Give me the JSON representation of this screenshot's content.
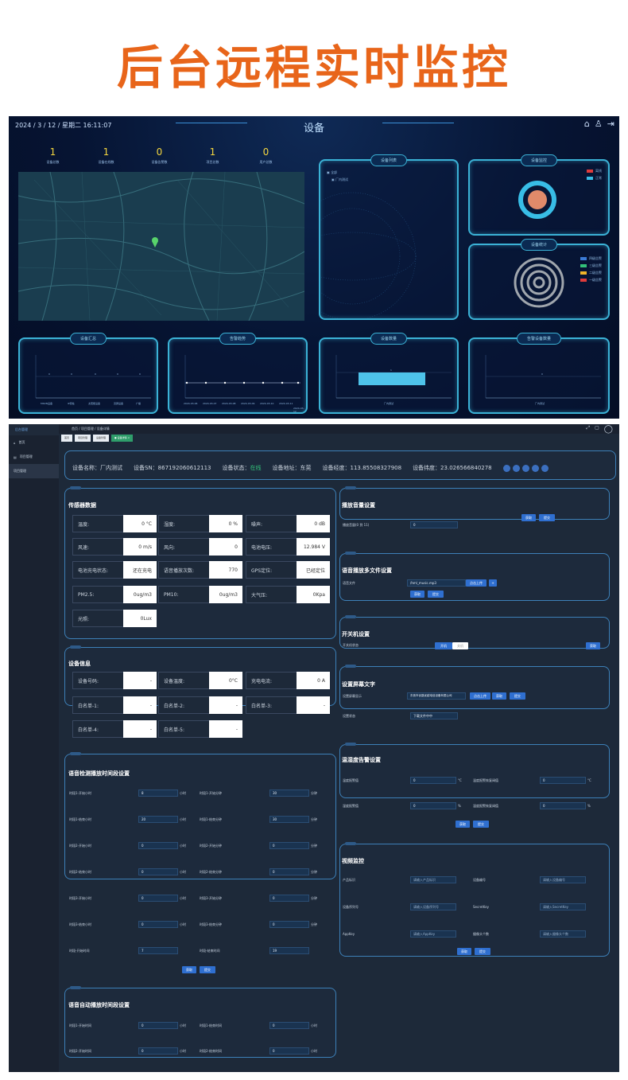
{
  "banner": {
    "title": "后台远程实时监控"
  },
  "dashboard": {
    "datetime": "2024 / 3 / 12 / 星期二 16:11:07",
    "title": "设备",
    "title_sub": "~~",
    "icons": [
      "home-icon",
      "user-icon",
      "logout-icon"
    ],
    "stats": [
      {
        "value": "1",
        "label": "设备总数"
      },
      {
        "value": "1",
        "label": "设备在线数"
      },
      {
        "value": "0",
        "label": "设备告警数"
      },
      {
        "value": "1",
        "label": "项目总数"
      },
      {
        "value": "0",
        "label": "用户总数"
      }
    ],
    "device_list": {
      "title": "设备列表",
      "items": [
        "全部",
        "厂内测试"
      ]
    },
    "device_monitor": {
      "title": "设备监控",
      "legend": [
        "离线",
        "正常"
      ],
      "colors": {
        "ring": "#38bde6",
        "core": "#e08a6a"
      }
    },
    "device_stats": {
      "title": "设备统计",
      "legend": [
        "四级告警",
        "三级告警",
        "二级告警",
        "一级告警"
      ],
      "legend_colors": [
        "#3b7bd6",
        "#33c27a",
        "#f0b429",
        "#e03b3b"
      ]
    },
    "bottom_panels": [
      {
        "title": "设备汇总",
        "labels": [
          "MSDN设备",
          "IP音柱",
          "太阳能设备",
          "双屏设备",
          "广播"
        ],
        "values": [
          0,
          0,
          0,
          0,
          0
        ]
      },
      {
        "title": "告警趋势",
        "labels": [
          "2024-03-06",
          "2024-03-07",
          "2024-03-08",
          "2024-03-09",
          "2024-03-10",
          "2024-03-11",
          "2024-03-12"
        ],
        "values": [
          0,
          0,
          0,
          0,
          0,
          0,
          0
        ]
      },
      {
        "title": "设备数量",
        "labels": [
          "厂内测试"
        ],
        "values": [
          1
        ]
      },
      {
        "title": "告警设备数量",
        "labels": [
          "厂内测试"
        ],
        "values": [
          0
        ]
      }
    ]
  },
  "admin": {
    "side_logo": "后台管理",
    "side_items": [
      "首页",
      "项目管理",
      "项目管理"
    ],
    "breadcrumb": "首页  /  项目管理  /  设备详情",
    "tabs": [
      "首页",
      "项目管理",
      "设备管理",
      "● 设备详情 ×"
    ],
    "info": {
      "name": "设备名称：厂内测试",
      "sn": "设备SN：867192060612113",
      "status_label": "设备状态：",
      "status_value": "在线",
      "address": "设备地址：东莞",
      "lng": "设备经度：113.85508327908",
      "lat": "设备纬度：23.026566840278"
    },
    "sensor": {
      "title": "传感器数据",
      "cells": [
        {
          "label": "温度:",
          "value": "0 °C"
        },
        {
          "label": "湿度:",
          "value": "0 %"
        },
        {
          "label": "噪声:",
          "value": "0 dB"
        },
        {
          "label": "风速:",
          "value": "0 m/s"
        },
        {
          "label": "风向:",
          "value": "0"
        },
        {
          "label": "电池电压:",
          "value": "12.984 V"
        },
        {
          "label": "电池充电状态:",
          "value": "还在充电"
        },
        {
          "label": "语音播放次数:",
          "value": "770"
        },
        {
          "label": "GPS定位:",
          "value": "已经定位"
        },
        {
          "label": "PM2.5:",
          "value": "0ug/m3"
        },
        {
          "label": "PM10:",
          "value": "0ug/m3"
        },
        {
          "label": "大气压:",
          "value": "0Kpa"
        },
        {
          "label": "光照:",
          "value": "0Lux"
        }
      ]
    },
    "device_info": {
      "title": "设备信息",
      "cells": [
        {
          "label": "设备号码:",
          "value": "-"
        },
        {
          "label": "设备温度:",
          "value": "0°C"
        },
        {
          "label": "充电电流:",
          "value": "0 A"
        },
        {
          "label": "白名单-1:",
          "value": "-"
        },
        {
          "label": "白名单-2:",
          "value": "-"
        },
        {
          "label": "白名单-3:",
          "value": "-"
        },
        {
          "label": "白名单-4:",
          "value": "-"
        },
        {
          "label": "白名单-5:",
          "value": "-"
        }
      ]
    },
    "voice_detect": {
      "title": "语音检测播放时间段设置",
      "rows": [
        [
          {
            "label": "时段1-开始小时",
            "value": "8",
            "unit": "小时"
          },
          {
            "label": "时段1-开始分钟",
            "value": "30",
            "unit": "分钟"
          }
        ],
        [
          {
            "label": "时段1-结束小时",
            "value": "20",
            "unit": "小时"
          },
          {
            "label": "时段1-结束分钟",
            "value": "30",
            "unit": "分钟"
          }
        ],
        [
          {
            "label": "时段2-开始小时",
            "value": "0",
            "unit": "小时"
          },
          {
            "label": "时段2-开始分钟",
            "value": "0",
            "unit": "分钟"
          }
        ],
        [
          {
            "label": "时段2-结束小时",
            "value": "0",
            "unit": "小时"
          },
          {
            "label": "时段2-结束分钟",
            "value": "0",
            "unit": "分钟"
          }
        ],
        [
          {
            "label": "时段3-开始小时",
            "value": "0",
            "unit": "小时"
          },
          {
            "label": "时段3-开始分钟",
            "value": "0",
            "unit": "分钟"
          }
        ],
        [
          {
            "label": "时段3-结束小时",
            "value": "0",
            "unit": "小时"
          },
          {
            "label": "时段3-结束分钟",
            "value": "0",
            "unit": "分钟"
          }
        ],
        [
          {
            "label": "时段-开始时间",
            "value": "7",
            "unit": ""
          },
          {
            "label": "时段-结束时间",
            "value": "19",
            "unit": ""
          }
        ]
      ],
      "btn_get": "获取",
      "btn_submit": "提交"
    },
    "voice_auto": {
      "title": "语音自动播放时间段设置",
      "rows": [
        [
          {
            "label": "时段1-开始时间",
            "value": "0",
            "unit": "小时"
          },
          {
            "label": "时段1-结束时间",
            "value": "0",
            "unit": "小时"
          }
        ],
        [
          {
            "label": "时段2-开始时间",
            "value": "0",
            "unit": "小时"
          },
          {
            "label": "时段2-结束时间",
            "value": "0",
            "unit": "小时"
          }
        ]
      ]
    },
    "volume": {
      "title": "播放音量设置",
      "label": "播放音量(0 到 11)",
      "value": "0",
      "btn_get": "获取",
      "btn_submit": "提交"
    },
    "voice_file": {
      "title": "语音播放多文件设置",
      "label": "语音文件",
      "value": "/hml_music.mp3",
      "btn_upload": "点击上传",
      "btn_plus": "+",
      "btn_get": "获取",
      "btn_submit": "提交"
    },
    "power": {
      "title": "开关机设置",
      "label": "开关机状态",
      "on": "开机",
      "off": "关机",
      "btn": "获取"
    },
    "screen_text": {
      "title": "设置屏幕文字",
      "label1": "设置屏幕显示",
      "value1": "东莞市优路优越电信设备有限公司",
      "btn_upload": "点击上传",
      "btn_get": "获取",
      "btn_submit": "提交",
      "label2": "设置状态",
      "value2": "下载文件中中"
    },
    "temp_alarm": {
      "title": "温湿度告警设置",
      "rows": [
        [
          {
            "label": "温度报警值",
            "value": "0",
            "unit": "°C"
          },
          {
            "label": "温度报警恢复阀值",
            "value": "0",
            "unit": "°C"
          }
        ],
        [
          {
            "label": "湿度报警值",
            "value": "0",
            "unit": "%"
          },
          {
            "label": "湿度报警恢复阀值",
            "value": "0",
            "unit": "%"
          }
        ]
      ],
      "btn_get": "获取",
      "btn_submit": "提交"
    },
    "video": {
      "title": "视频监控",
      "rows": [
        [
          {
            "label": "产品标识",
            "placeholder": "请输入产品标识"
          },
          {
            "label": "设备编号",
            "placeholder": "请输入设备编号"
          }
        ],
        [
          {
            "label": "设备序列号",
            "placeholder": "请输入设备序列号"
          },
          {
            "label": "SecretKey",
            "placeholder": "请输入SecretKey"
          }
        ],
        [
          {
            "label": "AppKey",
            "placeholder": "请输入AppKey"
          },
          {
            "label": "摄像头个数",
            "placeholder": "请输入摄像头个数"
          }
        ]
      ],
      "btn_get": "获取",
      "btn_submit": "提交"
    }
  }
}
